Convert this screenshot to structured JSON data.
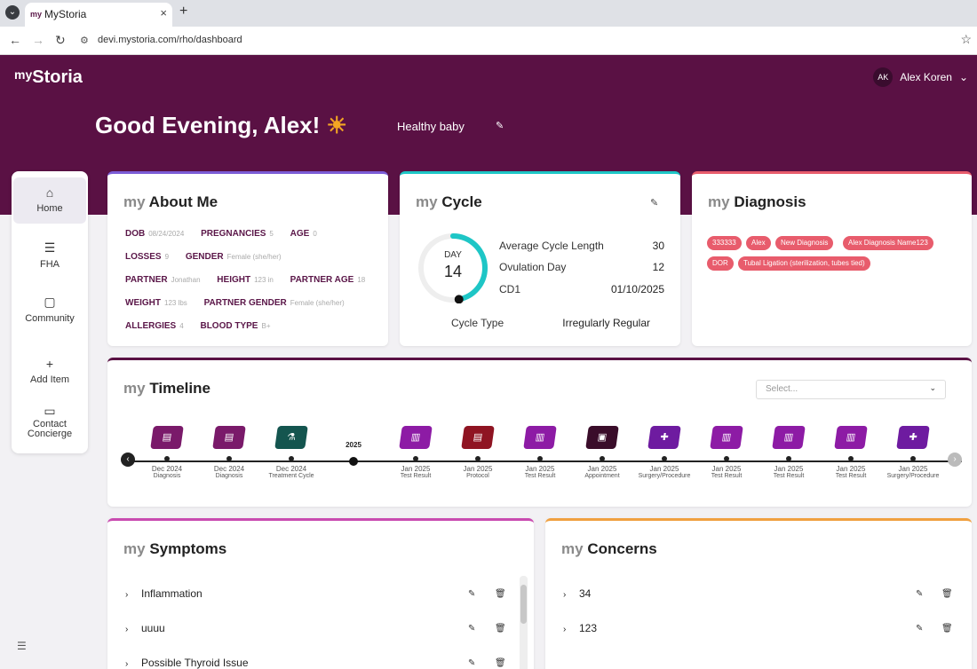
{
  "browser": {
    "tab_title": "MyStoria",
    "tab_favicon": "my",
    "url": "devi.mystoria.com/rho/dashboard"
  },
  "header": {
    "logo_my": "my",
    "logo_text": "Storia",
    "user_initials": "AK",
    "user_name": "Alex Koren",
    "greeting": "Good Evening, Alex!",
    "subtitle": "Healthy baby"
  },
  "sidebar": {
    "items": [
      {
        "label": "Home",
        "icon": "home-icon",
        "active": true
      },
      {
        "label": "FHA",
        "icon": "list-heart-icon"
      },
      {
        "label": "Community",
        "icon": "chat-bubbles-icon"
      },
      {
        "label": "Add Item",
        "icon": "plus-icon"
      },
      {
        "label": "Contact Concierge",
        "icon": "message-icon"
      }
    ]
  },
  "about": {
    "prefix": "my",
    "title": "About Me",
    "rows": [
      [
        {
          "label": "DOB",
          "value": "08/24/2024"
        },
        {
          "label": "PREGNANCIES",
          "value": "5"
        },
        {
          "label": "AGE",
          "value": "0"
        }
      ],
      [
        {
          "label": "LOSSES",
          "value": "9"
        },
        {
          "label": "GENDER",
          "value": "Female (she/her)"
        }
      ],
      [
        {
          "label": "PARTNER",
          "value": "Jonathan"
        },
        {
          "label": "HEIGHT",
          "value": "123 in"
        },
        {
          "label": "PARTNER AGE",
          "value": "18"
        }
      ],
      [
        {
          "label": "WEIGHT",
          "value": "123 lbs"
        },
        {
          "label": "PARTNER GENDER",
          "value": "Female (she/her)"
        }
      ],
      [
        {
          "label": "ALLERGIES",
          "value": "4"
        },
        {
          "label": "BLOOD TYPE",
          "value": "B+"
        }
      ]
    ]
  },
  "cycle": {
    "prefix": "my",
    "title": "Cycle",
    "day_label": "DAY",
    "day_value": "14",
    "progress": 0.47,
    "avg_label": "Average Cycle Length",
    "avg_value": "30",
    "ovulation_label": "Ovulation Day",
    "ovulation_value": "12",
    "cd1_label": "CD1",
    "cd1_value": "01/10/2025",
    "type_label": "Cycle Type",
    "type_value": "Irregularly Regular",
    "accent": "#1ec6c6"
  },
  "diagnosis": {
    "prefix": "my",
    "title": "Diagnosis",
    "tags": [
      "333333",
      "Alex",
      "New Diagnosis",
      "Alex Diagnosis Name123",
      "DOR",
      "Tubal Ligation (sterilization, tubes tied)"
    ]
  },
  "timeline": {
    "prefix": "my",
    "title": "Timeline",
    "select_placeholder": "Select...",
    "year_label": "2025",
    "events": [
      {
        "date": "Dec 2024",
        "type": "Diagnosis",
        "color": "#7a1a6a"
      },
      {
        "date": "Dec 2024",
        "type": "Diagnosis",
        "color": "#7a1a6a"
      },
      {
        "date": "Dec 2024",
        "type": "Treatment Cycle",
        "color": "#14554f"
      },
      {
        "date": "Jan 2025",
        "type": "Test Result",
        "color": "#8d1ba5"
      },
      {
        "date": "Jan 2025",
        "type": "Protocol",
        "color": "#8f1422"
      },
      {
        "date": "Jan 2025",
        "type": "Test Result",
        "color": "#8d1ba5"
      },
      {
        "date": "Jan 2025",
        "type": "Appointment",
        "color": "#3a0d2a"
      },
      {
        "date": "Jan 2025",
        "type": "Surgery/Procedure",
        "color": "#6e1ba0"
      },
      {
        "date": "Jan 2025",
        "type": "Test Result",
        "color": "#8d1ba5"
      },
      {
        "date": "Jan 2025",
        "type": "Test Result",
        "color": "#8d1ba5"
      },
      {
        "date": "Jan 2025",
        "type": "Test Result",
        "color": "#8d1ba5"
      },
      {
        "date": "Jan 2025",
        "type": "Surgery/Procedure",
        "color": "#6e1ba0"
      }
    ]
  },
  "symptoms": {
    "prefix": "my",
    "title": "Symptoms",
    "items": [
      "Inflammation",
      "uuuu",
      "Possible Thyroid Issue"
    ]
  },
  "concerns": {
    "prefix": "my",
    "title": "Concerns",
    "items": [
      "34",
      "123"
    ]
  },
  "colors": {
    "brand": "#5a1144",
    "about_border": "#7b5cd6",
    "cycle_border": "#1ec6c6",
    "diagnosis_border": "#e85c6c",
    "timeline_border": "#5a1144",
    "symptoms_border": "#c94bb0",
    "concerns_border": "#f0a040"
  }
}
